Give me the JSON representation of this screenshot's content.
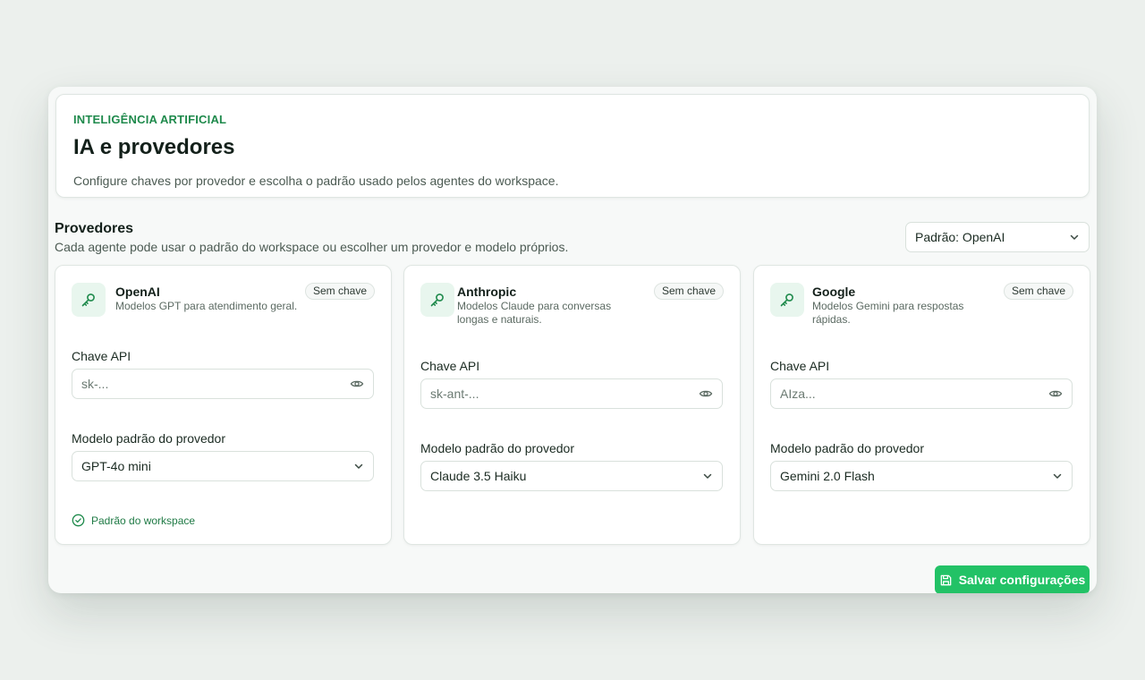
{
  "header": {
    "eyebrow": "INTELIGÊNCIA ARTIFICIAL",
    "title": "IA e provedores",
    "subtitle": "Configure chaves por provedor e escolha o padrão usado pelos agentes do workspace."
  },
  "section": {
    "title": "Provedores",
    "subtitle": "Cada agente pode usar o padrão do workspace ou escolher um provedor e modelo próprios.",
    "default_select": "Padrão: OpenAI"
  },
  "providers": [
    {
      "name": "OpenAI",
      "description": "Modelos GPT para atendimento geral.",
      "badge": "Sem chave",
      "api_label": "Chave API",
      "api_placeholder": "sk-...",
      "model_label": "Modelo padrão do provedor",
      "model_value": "GPT-4o mini",
      "workspace_default": "Padrão do workspace"
    },
    {
      "name": "Anthropic",
      "description": "Modelos Claude para conversas longas e naturais.",
      "badge": "Sem chave",
      "api_label": "Chave API",
      "api_placeholder": "sk-ant-...",
      "model_label": "Modelo padrão do provedor",
      "model_value": "Claude 3.5 Haiku"
    },
    {
      "name": "Google",
      "description": "Modelos Gemini para respostas rápidas.",
      "badge": "Sem chave",
      "api_label": "Chave API",
      "api_placeholder": "AIza...",
      "model_label": "Modelo padrão do provedor",
      "model_value": "Gemini 2.0 Flash"
    }
  ],
  "save_label": "Salvar configurações",
  "colors": {
    "accent": "#22c266",
    "eyebrow": "#1f8a4c",
    "icon_bg": "#e8f6ee"
  },
  "icons": {
    "provider": "key-icon",
    "reveal": "eye-icon",
    "dropdown": "chevron-down-icon",
    "default": "check-circle-icon",
    "save": "save-icon"
  }
}
